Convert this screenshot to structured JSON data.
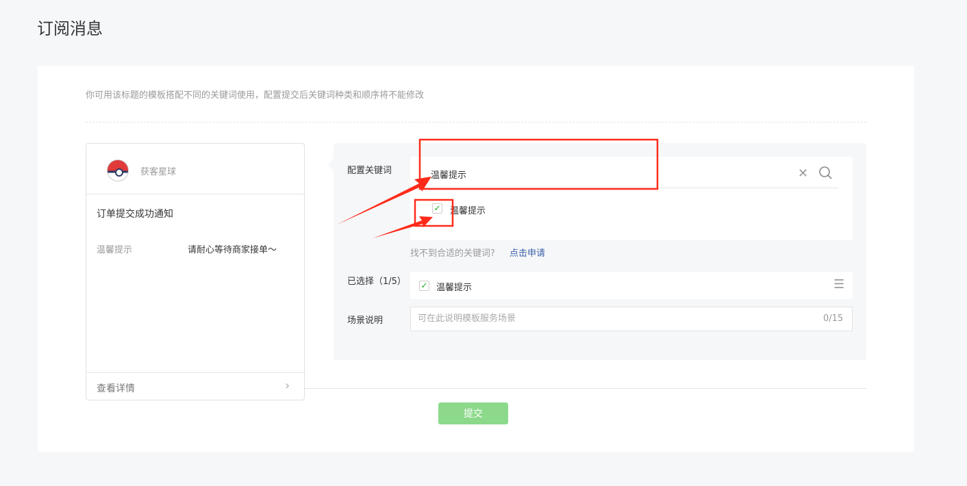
{
  "page": {
    "title": "订阅消息"
  },
  "card": {
    "tip": "你可用该标题的模板搭配不同的关键词使用，配置提交后关键词种类和顺序将不能修改"
  },
  "preview": {
    "brand": "获客星球",
    "message_title": "订单提交成功通知",
    "keyword_label": "温馨提示",
    "keyword_value": "请耐心等待商家接单～",
    "detail_label": "查看详情"
  },
  "form": {
    "keyword_label": "配置关键词",
    "search_value": "温馨提示",
    "option_label": "温馨提示",
    "hint": "找不到合适的关键词?",
    "apply_link": "点击申请",
    "selected_label": "已选择（1/5）",
    "selected_item": "温馨提示",
    "scene_label": "场景说明",
    "scene_placeholder": "可在此说明模板服务场景",
    "scene_count": "0/15"
  },
  "submit_label": "提交",
  "colors": {
    "accent": "#1aad19",
    "submit": "#8cd98b",
    "link": "#3a62a8",
    "annotation": "#ff2a1a"
  }
}
